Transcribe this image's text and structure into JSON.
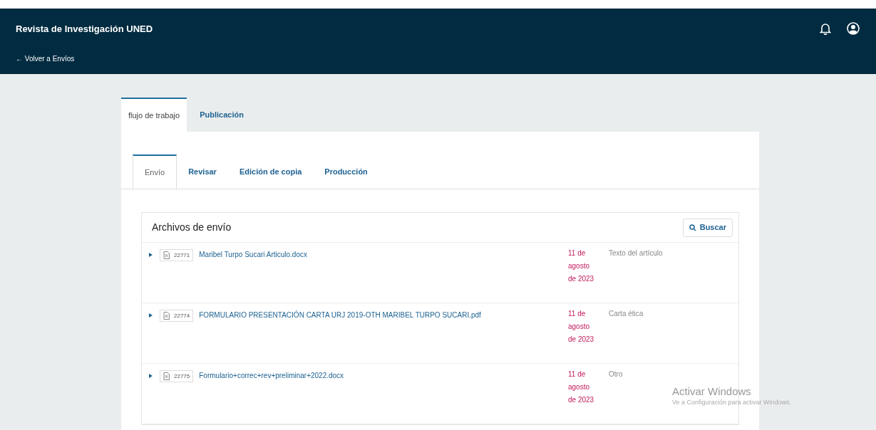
{
  "header": {
    "title": "Revista de Investigación UNED",
    "back_link": "← Volver a Envíos"
  },
  "main_tabs": [
    {
      "label": "flujo de trabajo",
      "selected": true
    },
    {
      "label": "Publicación",
      "selected": false
    }
  ],
  "stage_tabs": [
    {
      "label": "Envío",
      "selected": true
    },
    {
      "label": "Revisar",
      "selected": false
    },
    {
      "label": "Edición de copia",
      "selected": false
    },
    {
      "label": "Producción",
      "selected": false
    }
  ],
  "files_panel": {
    "title": "Archivos de envío",
    "search_button": "Buscar",
    "rows": [
      {
        "id": "22771",
        "name": "Maribel Turpo Sucari Articulo.docx",
        "date": "11 de agosto de 2023",
        "type": "Texto del artículo"
      },
      {
        "id": "22774",
        "name": "FORMULARIO PRESENTACIÓN CARTA URJ 2019-OTH MARIBEL TURPO SUCARI.pdf",
        "date": "11 de agosto de 2023",
        "type": "Carta ética"
      },
      {
        "id": "22775",
        "name": "Formulario+correc+rev+preliminar+2022.docx",
        "date": "11 de agosto de 2023",
        "type": "Otro"
      }
    ]
  },
  "os_notice": {
    "title": "Activar Windows",
    "subtitle": "Ve a Configuración para activar Windows."
  }
}
